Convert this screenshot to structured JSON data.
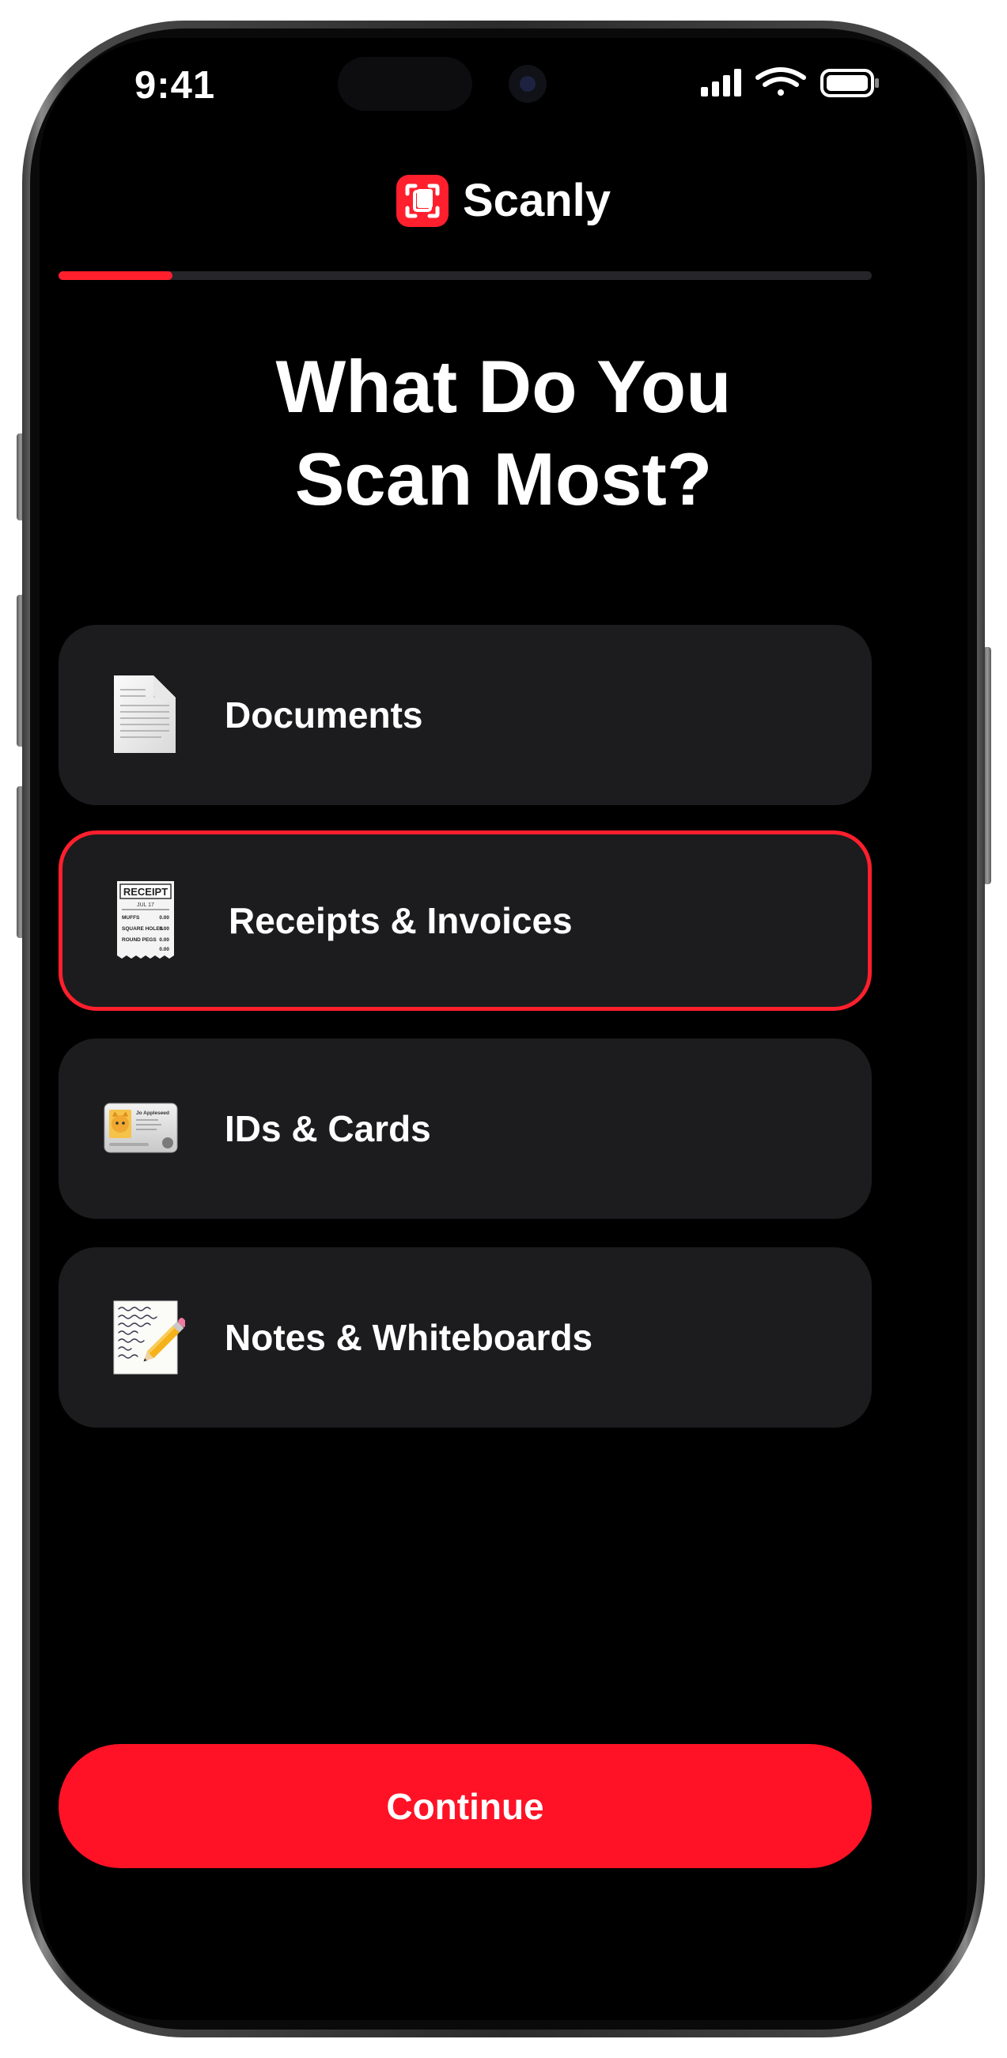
{
  "status_bar": {
    "time": "9:41"
  },
  "app": {
    "name": "Scanly",
    "accent": "#ff1f2d"
  },
  "progress": {
    "fraction": 0.14
  },
  "heading": {
    "line1": "What Do You",
    "line2": "Scan Most?"
  },
  "options": [
    {
      "label": "Documents",
      "icon": "document-icon",
      "selected": false
    },
    {
      "label": "Receipts & Invoices",
      "icon": "receipt-icon",
      "selected": true
    },
    {
      "label": "IDs & Cards",
      "icon": "id-card-icon",
      "selected": false
    },
    {
      "label": "Notes & Whiteboards",
      "icon": "memo-icon",
      "selected": false
    }
  ],
  "receipt_icon_text": {
    "title": "RECEIPT",
    "date": "JUL 17",
    "row1": "MUFFS",
    "row2": "SQUARE HOLES",
    "row3": "ROUND PEGS",
    "amount": "0.00"
  },
  "id_card_icon_text": {
    "name": "Jo Appleseed"
  },
  "footer": {
    "continue_label": "Continue"
  }
}
